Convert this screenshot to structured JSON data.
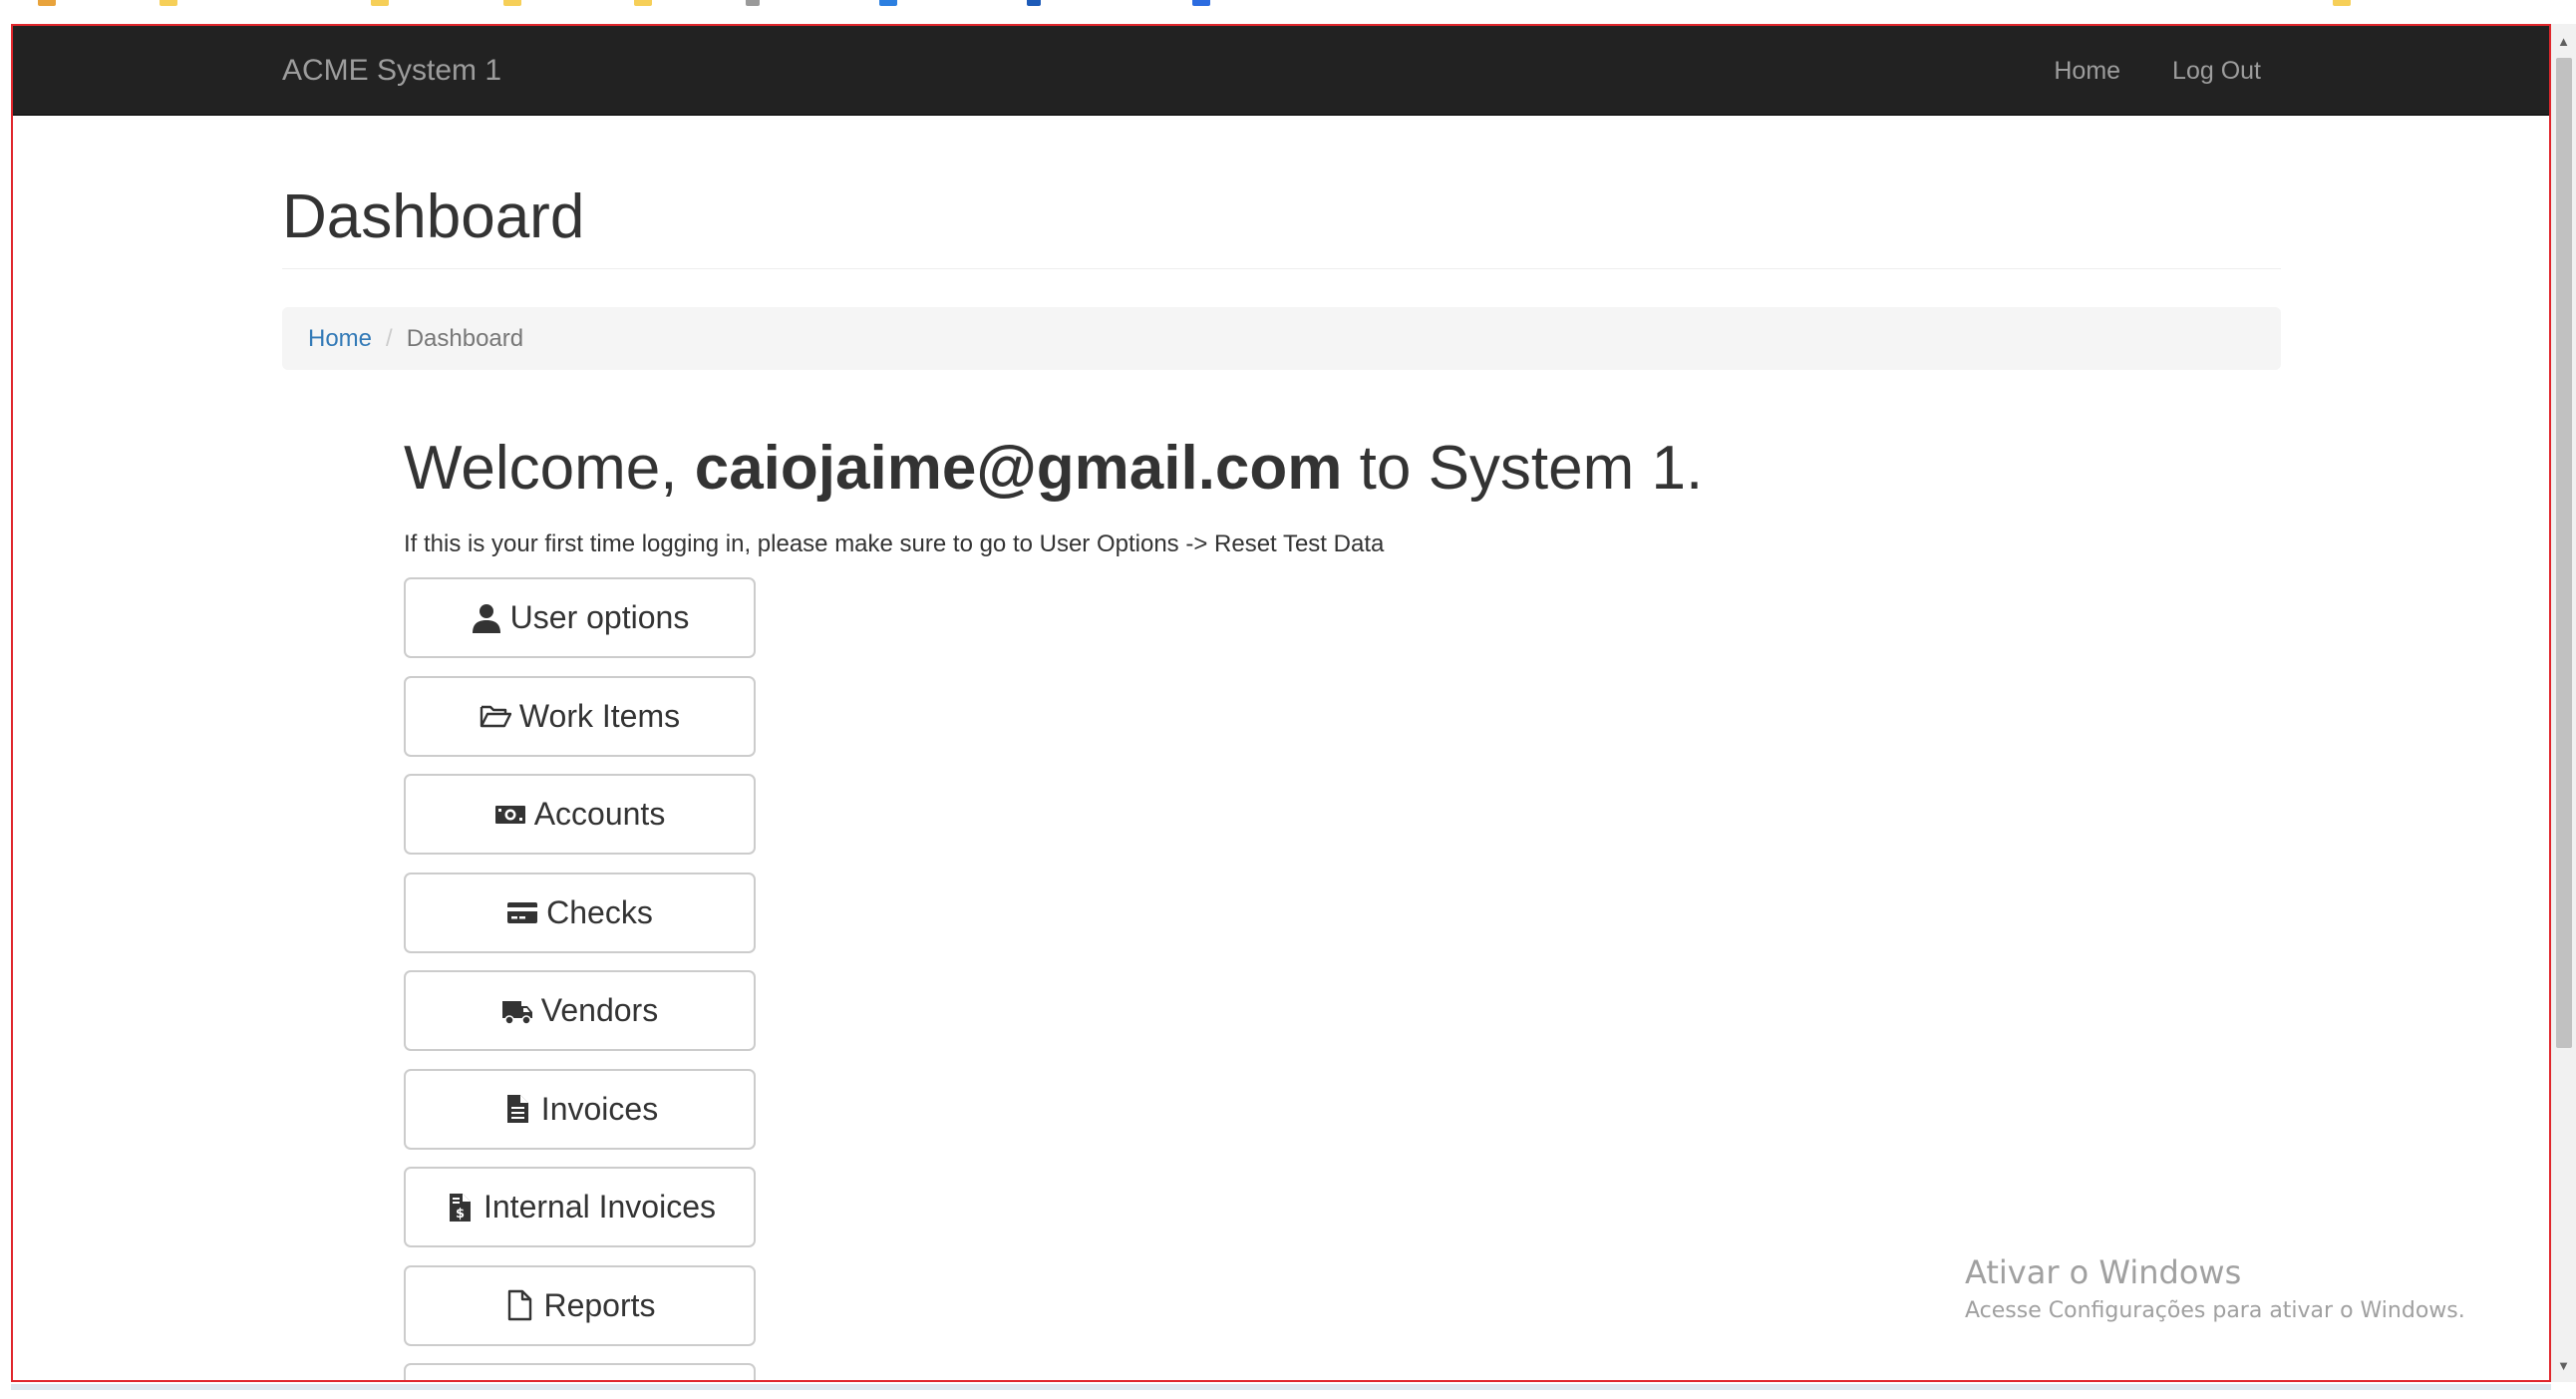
{
  "app": {
    "brand": "ACME System 1",
    "nav": [
      "Home",
      "Log Out"
    ]
  },
  "page": {
    "title": "Dashboard",
    "breadcrumb": {
      "home": "Home",
      "separator": "/",
      "current": "Dashboard"
    },
    "welcome": {
      "prefix": "Welcome, ",
      "email": "caiojaime@gmail.com",
      "suffix": " to System 1."
    },
    "notice": "If this is your first time logging in, please make sure to go to User Options -> Reset Test Data"
  },
  "menu": [
    {
      "label": "User options",
      "icon": "user-icon"
    },
    {
      "label": "Work Items",
      "icon": "folder-open-icon"
    },
    {
      "label": "Accounts",
      "icon": "money-icon"
    },
    {
      "label": "Checks",
      "icon": "credit-card-icon"
    },
    {
      "label": "Vendors",
      "icon": "truck-icon"
    },
    {
      "label": "Invoices",
      "icon": "file-text-icon"
    },
    {
      "label": "Internal Invoices",
      "icon": "file-invoice-dollar-icon"
    },
    {
      "label": "Reports",
      "icon": "file-icon"
    }
  ],
  "watermark": {
    "title": "Ativar o Windows",
    "subtitle": "Acesse Configurações para ativar o Windows."
  },
  "colors": {
    "navbar": "#222222",
    "nav_text": "#9d9d9d",
    "link": "#337ab7",
    "frame": "#e0262c"
  }
}
